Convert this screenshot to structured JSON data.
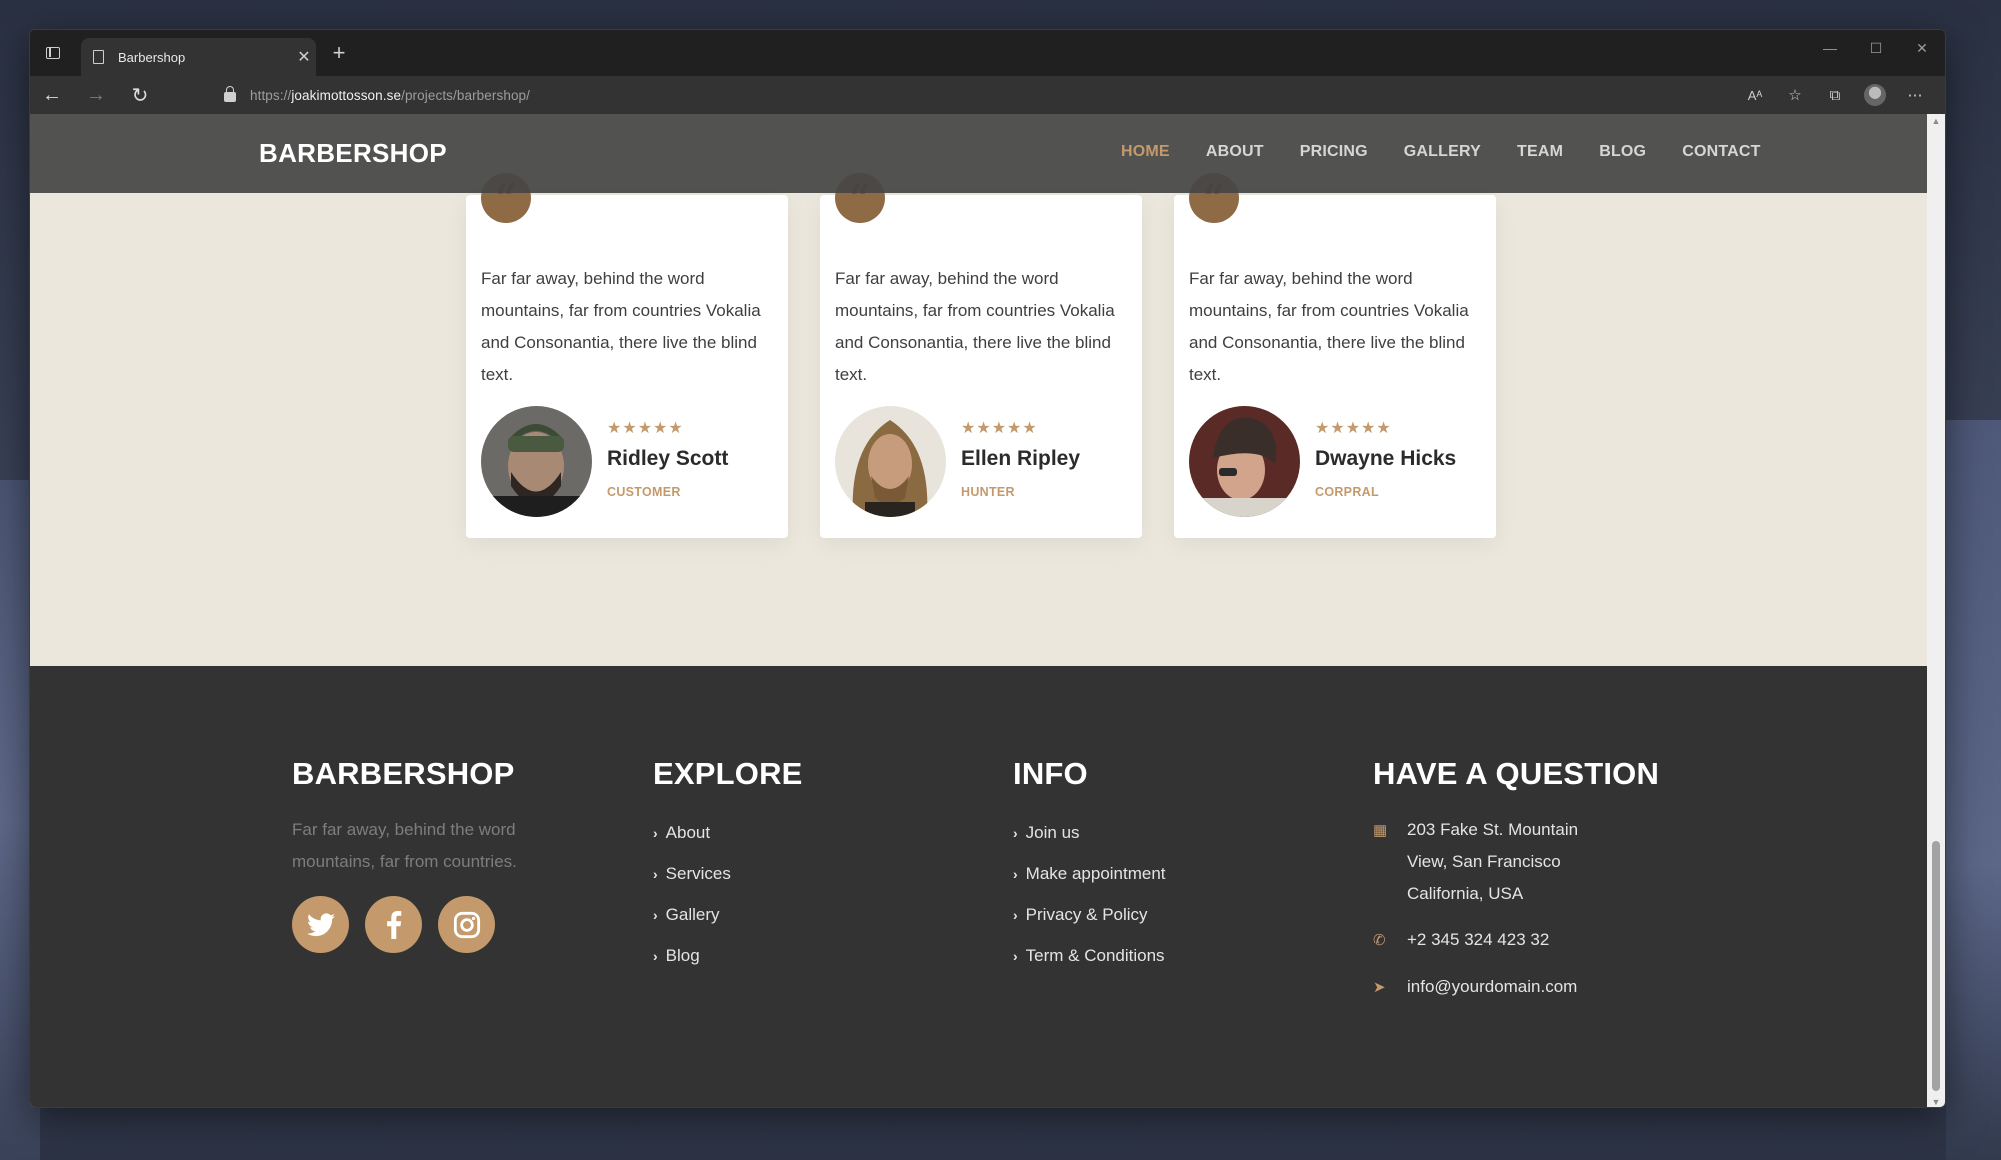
{
  "browser": {
    "tab_title": "Barbershop",
    "url_scheme": "https://",
    "url_host": "joakimottosson.se",
    "url_path": "/projects/barbershop/"
  },
  "site": {
    "logo": "BARBERSHOP",
    "menu": [
      {
        "label": "HOME",
        "active": true
      },
      {
        "label": "ABOUT"
      },
      {
        "label": "PRICING"
      },
      {
        "label": "GALLERY"
      },
      {
        "label": "TEAM"
      },
      {
        "label": "BLOG"
      },
      {
        "label": "CONTACT"
      }
    ]
  },
  "testimonials": [
    {
      "text": "Far far away, behind the word mountains, far from countries Vokalia and Consonantia, there live the blind text.",
      "stars": "★★★★★",
      "name": "Ridley Scott",
      "role": "CUSTOMER"
    },
    {
      "text": "Far far away, behind the word mountains, far from countries Vokalia and Consonantia, there live the blind text.",
      "stars": "★★★★★",
      "name": "Ellen Ripley",
      "role": "HUNTER"
    },
    {
      "text": "Far far away, behind the word mountains, far from countries Vokalia and Consonantia, there live the blind text.",
      "stars": "★★★★★",
      "name": "Dwayne Hicks",
      "role": "CORPRAL"
    }
  ],
  "footer": {
    "brand": {
      "title": "BARBERSHOP",
      "desc": "Far far away, behind the word mountains, far from countries."
    },
    "explore": {
      "title": "EXPLORE",
      "links": [
        "About",
        "Services",
        "Gallery",
        "Blog"
      ]
    },
    "info": {
      "title": "INFO",
      "links": [
        "Join us",
        "Make appointment",
        "Privacy & Policy",
        "Term & Conditions"
      ]
    },
    "contact": {
      "title": "HAVE A QUESTION",
      "address": [
        "203 Fake St. Mountain",
        "View, San Francisco",
        "California, USA"
      ],
      "phone": "+2 345 324 423 32",
      "email": "info@yourdomain.com"
    }
  },
  "colors": {
    "accent": "#c49a6c",
    "footer_bg": "#333333",
    "section_bg": "#ebe7dd"
  }
}
